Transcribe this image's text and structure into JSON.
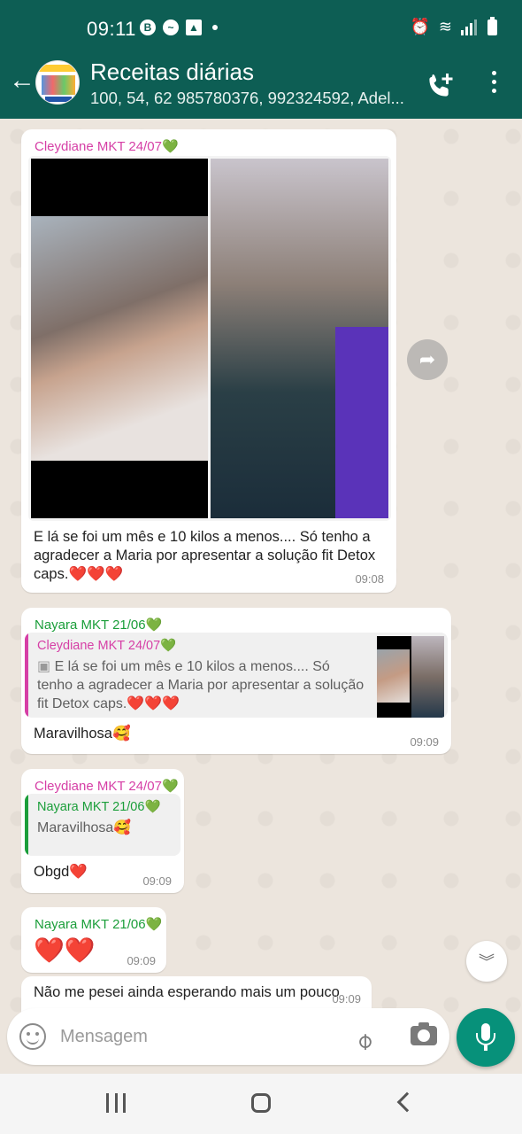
{
  "status_bar": {
    "time": "09:11",
    "icons": [
      "b-badge-icon",
      "messenger-icon",
      "image-icon",
      "dot-icon",
      "alarm-icon",
      "wifi-icon",
      "signal-icon",
      "battery-icon"
    ]
  },
  "header": {
    "title": "Receitas diárias",
    "subtitle": "100, 54, 62 985780376, 992324592, Adel...",
    "avatar_text": "SE ACONTE",
    "back_icon": "back-arrow-icon",
    "call_icon": "add-call-icon",
    "menu_icon": "more-vert-icon"
  },
  "colors": {
    "header_bg": "#0d5e54",
    "chat_bg": "#ece5dd",
    "bubble_bg": "#ffffff",
    "sender_pink": "#d63fa6",
    "sender_green": "#1b9e3a",
    "heart_red": "#e0262b",
    "mic_button": "#07917a"
  },
  "messages": [
    {
      "sender": "Cleydiane MKT 24/07",
      "sender_emoji": "💚",
      "has_image": true,
      "text": "E lá se foi um mês e 10 kilos a menos.... Só tenho a agradecer a Maria por apresentar a solução fit Detox caps.",
      "text_emoji": "❤️❤️❤️",
      "time": "09:08"
    },
    {
      "sender": "Nayara MKT 21/06",
      "sender_emoji": "💚",
      "quote": {
        "sender": "Cleydiane MKT 24/07",
        "sender_emoji": "💚",
        "text": "E lá se foi um mês e 10 kilos a menos.... Só tenho a agradecer a Maria por apresentar a solução fit Detox caps.",
        "text_emoji": "❤️❤️❤️"
      },
      "text": "Maravilhosa",
      "text_emoji": "🥰",
      "time": "09:09"
    },
    {
      "sender": "Cleydiane MKT 24/07",
      "sender_emoji": "💚",
      "quote": {
        "sender": "Nayara MKT 21/06",
        "sender_emoji": "💚",
        "text": "Maravilhosa",
        "text_emoji": "🥰"
      },
      "text": "Obgd",
      "text_emoji": "❤️",
      "time": "09:09"
    },
    {
      "sender": "Nayara MKT 21/06",
      "sender_emoji": "💚",
      "text": "",
      "text_emoji": "❤️❤️",
      "time": "09:09"
    },
    {
      "text": "Não me pesei ainda esperando mais um pouco",
      "time": "09:09"
    }
  ],
  "input": {
    "placeholder": "Mensagem"
  }
}
